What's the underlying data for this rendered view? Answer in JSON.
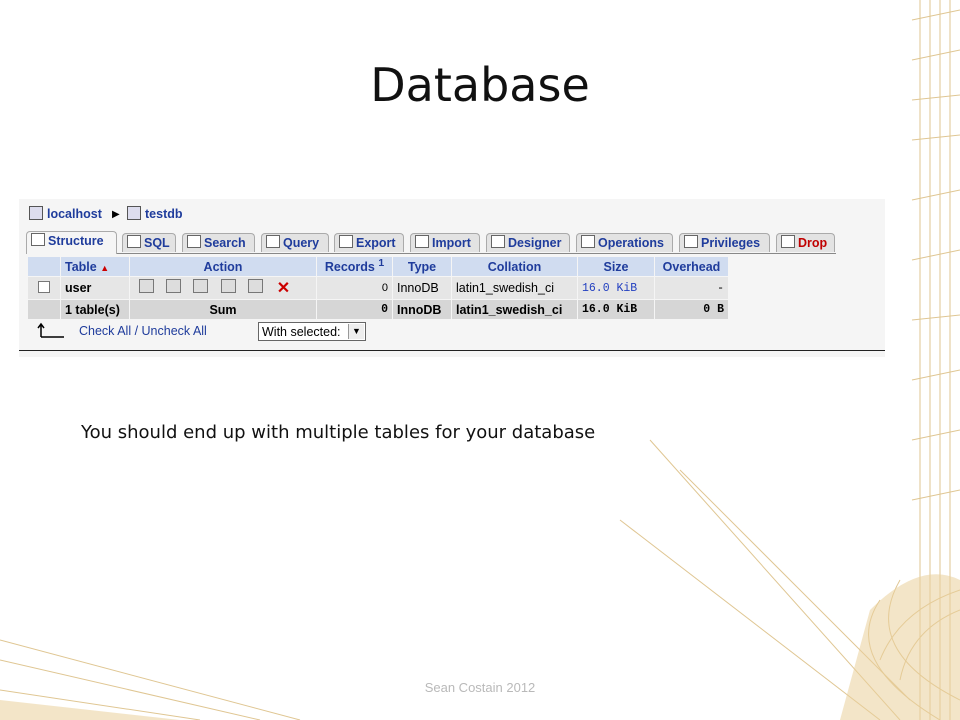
{
  "slide": {
    "title": "Database",
    "caption": "You should end up with multiple tables for your database",
    "footer": "Sean Costain 2012"
  },
  "breadcrumb": {
    "server": "localhost",
    "database": "testdb"
  },
  "tabs": [
    {
      "label": "Structure",
      "icon": "structure-icon"
    },
    {
      "label": "SQL",
      "icon": "sql-icon"
    },
    {
      "label": "Search",
      "icon": "search-icon"
    },
    {
      "label": "Query",
      "icon": "query-icon"
    },
    {
      "label": "Export",
      "icon": "export-icon"
    },
    {
      "label": "Import",
      "icon": "import-icon"
    },
    {
      "label": "Designer",
      "icon": "designer-icon"
    },
    {
      "label": "Operations",
      "icon": "operations-icon"
    },
    {
      "label": "Privileges",
      "icon": "privileges-icon"
    },
    {
      "label": "Drop",
      "icon": "drop-icon"
    }
  ],
  "table": {
    "headers": {
      "table": "Table",
      "action": "Action",
      "records": "Records",
      "records_note": "1",
      "type": "Type",
      "collation": "Collation",
      "size": "Size",
      "overhead": "Overhead"
    },
    "rows": [
      {
        "name": "user",
        "records": "0",
        "type": "InnoDB",
        "collation": "latin1_swedish_ci",
        "size": "16.0 KiB",
        "overhead": "-"
      }
    ],
    "summary": {
      "name": "1 table(s)",
      "label": "Sum",
      "records": "0",
      "type": "InnoDB",
      "collation": "latin1_swedish_ci",
      "size": "16.0 KiB",
      "overhead": "0 B"
    }
  },
  "footer_controls": {
    "check_all": "Check All",
    "separator": " / ",
    "uncheck_all": "Uncheck All",
    "with_selected": "With selected:"
  },
  "colors": {
    "link": "#1f3c9c",
    "drop": "#c00000",
    "header_bg": "#d0dcf0",
    "ornament": "#d6b370"
  }
}
